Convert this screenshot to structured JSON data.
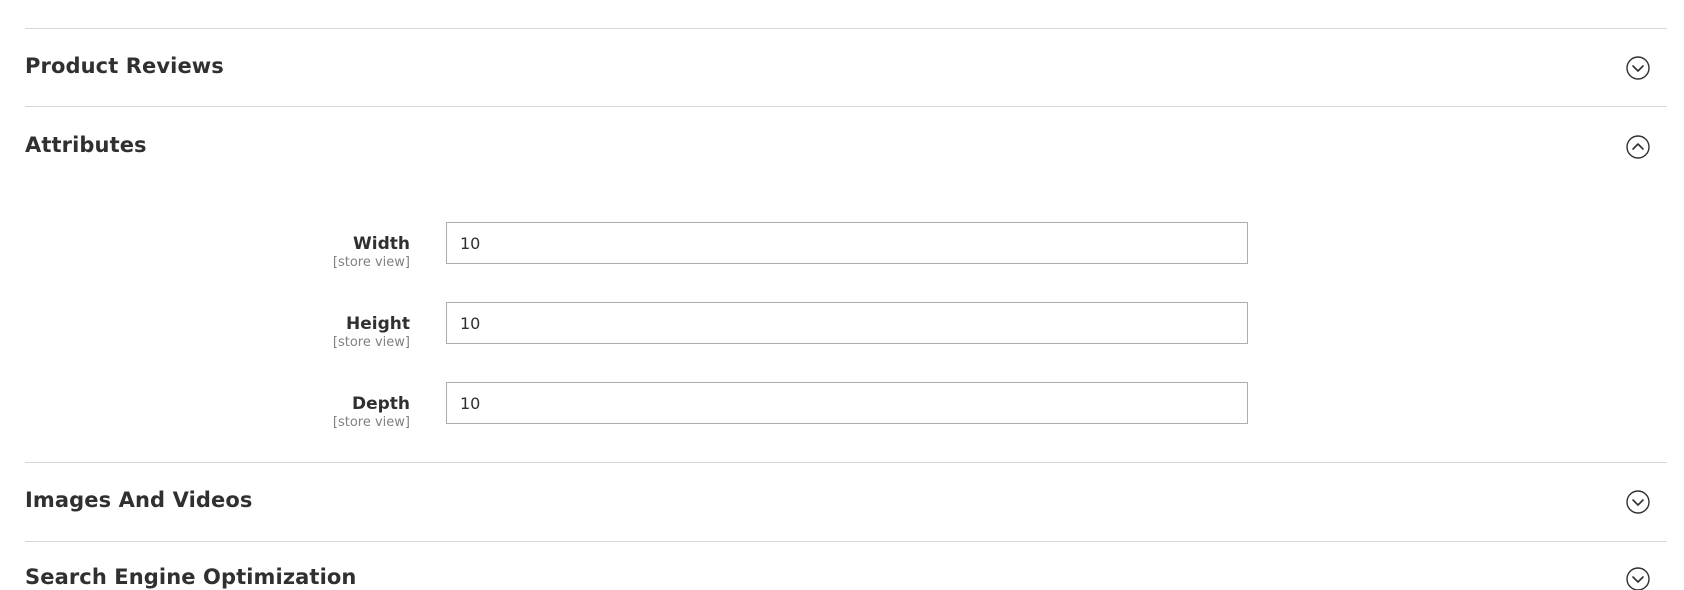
{
  "sections": {
    "product_reviews": {
      "title": "Product Reviews",
      "state": "collapsed",
      "icon": "chevron-down-circle-icon"
    },
    "attributes": {
      "title": "Attributes",
      "state": "expanded",
      "icon": "chevron-up-circle-icon",
      "fields": [
        {
          "label": "Width",
          "scope": "[store view]",
          "value": "10"
        },
        {
          "label": "Height",
          "scope": "[store view]",
          "value": "10"
        },
        {
          "label": "Depth",
          "scope": "[store view]",
          "value": "10"
        }
      ]
    },
    "images_and_videos": {
      "title": "Images And Videos",
      "state": "collapsed",
      "icon": "chevron-down-circle-icon"
    },
    "seo": {
      "title": "Search Engine Optimization",
      "state": "collapsed",
      "icon": "chevron-down-circle-icon"
    }
  },
  "colors": {
    "text": "#303030",
    "scope_text": "#808080",
    "divider": "#d6d6d6",
    "input_border": "#adadad"
  }
}
